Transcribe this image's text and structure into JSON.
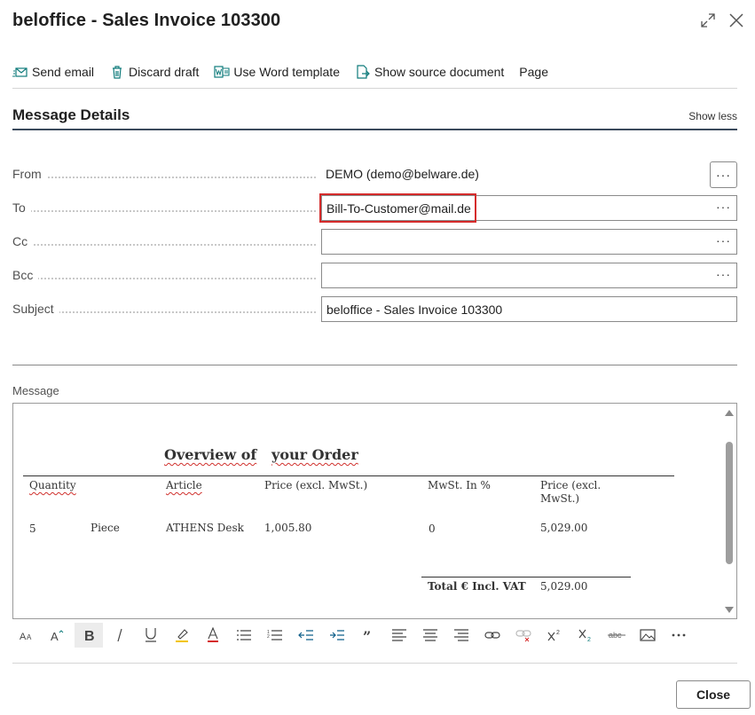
{
  "window": {
    "title": "beloffice - Sales Invoice 103300",
    "expand_icon": "expand-icon",
    "close_icon": "close-icon"
  },
  "toolbar": {
    "items": [
      {
        "label": "Send email",
        "icon": "send-email-icon"
      },
      {
        "label": "Discard draft",
        "icon": "trash-icon"
      },
      {
        "label": "Use Word template",
        "icon": "word-template-icon"
      },
      {
        "label": "Show source document",
        "icon": "source-document-icon"
      },
      {
        "label": "Page",
        "icon": ""
      }
    ]
  },
  "section": {
    "title": "Message Details",
    "toggle_label": "Show less"
  },
  "fields": {
    "from": {
      "label": "From",
      "value": "DEMO (demo@belware.de)"
    },
    "to": {
      "label": "To",
      "value": "Bill-To-Customer@mail.de"
    },
    "cc": {
      "label": "Cc",
      "value": ""
    },
    "bcc": {
      "label": "Bcc",
      "value": ""
    },
    "subject": {
      "label": "Subject",
      "value": "beloffice - Sales Invoice 103300"
    },
    "more_label": "···"
  },
  "message": {
    "label": "Message",
    "heading_part1": "Overview of",
    "heading_part2": "your Order",
    "columns": [
      "Quantity",
      "Article",
      "Price (excl. MwSt.)",
      "MwSt. In %",
      "Price (excl. MwSt.)"
    ],
    "row": {
      "quantity": "5",
      "unit": "Piece",
      "article": "ATHENS Desk",
      "price": "1,005.80",
      "vat": "0",
      "total": "5,029.00"
    },
    "total_label": "Total € Incl. VAT",
    "total_value": "5,029.00"
  },
  "format_toolbar": [
    "font-size-icon",
    "font-grow-icon",
    "bold-icon",
    "italic-icon",
    "underline-icon",
    "highlight-icon",
    "font-color-icon",
    "bullet-list-icon",
    "numbered-list-icon",
    "outdent-icon",
    "indent-icon",
    "quote-icon",
    "align-left-icon",
    "align-center-icon",
    "align-right-icon",
    "link-icon",
    "unlink-icon",
    "superscript-icon",
    "subscript-icon",
    "strikethrough-icon",
    "image-icon",
    "more-icon"
  ],
  "footer": {
    "close_label": "Close"
  },
  "colors": {
    "accent": "#3a4a5c",
    "highlight_border": "#d52b2b",
    "icon_teal": "#0f7b7b"
  }
}
